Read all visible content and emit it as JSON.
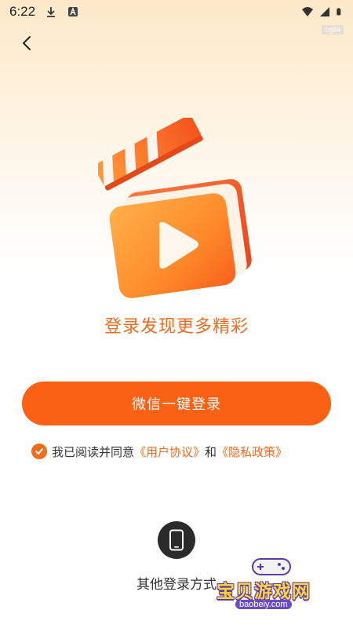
{
  "status_bar": {
    "time": "6:22"
  },
  "tag": "cg64",
  "headline": "登录发现更多精彩",
  "wechat_login": {
    "label": "微信一键登录"
  },
  "agreement": {
    "prefix": "我已阅读并同意",
    "user_agreement": "《用户协议》",
    "conjunction": "和",
    "privacy_policy": "《隐私政策》",
    "checked": true
  },
  "other_login": {
    "label": "其他登录方式",
    "icon": "phone-icon"
  },
  "watermark": {
    "title": "宝贝游戏网",
    "url": "baobeiy.com"
  },
  "colors": {
    "accent": "#fa6114",
    "text": "#333333"
  }
}
